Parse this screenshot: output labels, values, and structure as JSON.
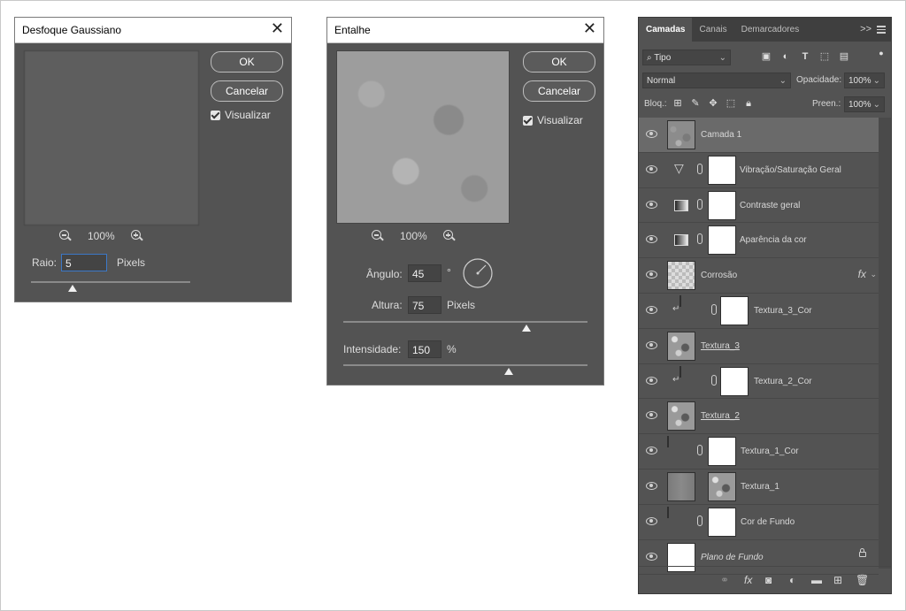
{
  "gaussian": {
    "title": "Desfoque Gaussiano",
    "ok": "OK",
    "cancel": "Cancelar",
    "preview_label": "Visualizar",
    "zoom": "100%",
    "radius_label": "Raio:",
    "radius_value": "5",
    "radius_unit": "Pixels"
  },
  "emboss": {
    "title": "Entalhe",
    "ok": "OK",
    "cancel": "Cancelar",
    "preview_label": "Visualizar",
    "zoom": "100%",
    "angle_label": "Ângulo:",
    "angle_value": "45",
    "angle_unit": "°",
    "height_label": "Altura:",
    "height_value": "75",
    "height_unit": "Pixels",
    "amount_label": "Intensidade:",
    "amount_value": "150",
    "amount_unit": "%"
  },
  "layers_panel": {
    "tabs": [
      "Camadas",
      "Canais",
      "Demarcadores"
    ],
    "filter_label": "Tipo",
    "blend_mode": "Normal",
    "opacity_label": "Opacidade:",
    "opacity_value": "100%",
    "lock_label": "Bloq.:",
    "fill_label": "Preen.:",
    "fill_value": "100%",
    "fx_label": "fx",
    "layers": [
      {
        "name": "Camada 1",
        "selected": true
      },
      {
        "name": "Vibração/Saturação Geral"
      },
      {
        "name": "Contraste geral"
      },
      {
        "name": "Aparência da cor"
      },
      {
        "name": "Corrosão",
        "fx": true
      },
      {
        "name": "Textura_3_Cor",
        "color": "#f3a33c"
      },
      {
        "name": "Textura_3"
      },
      {
        "name": "Textura_2_Cor",
        "color": "#f3a33c"
      },
      {
        "name": "Textura_2"
      },
      {
        "name": "Textura_1_Cor",
        "color": "#6b2412"
      },
      {
        "name": "Textura_1"
      },
      {
        "name": "Cor de Fundo",
        "color": "#6b2412"
      },
      {
        "name": "Plano de Fundo",
        "locked": true
      }
    ]
  },
  "colors": {
    "dialog_bg": "#535353",
    "panel_bg": "#535353",
    "orange": "#f3a33c",
    "brown": "#6b2412",
    "focus": "#3c78c7"
  }
}
